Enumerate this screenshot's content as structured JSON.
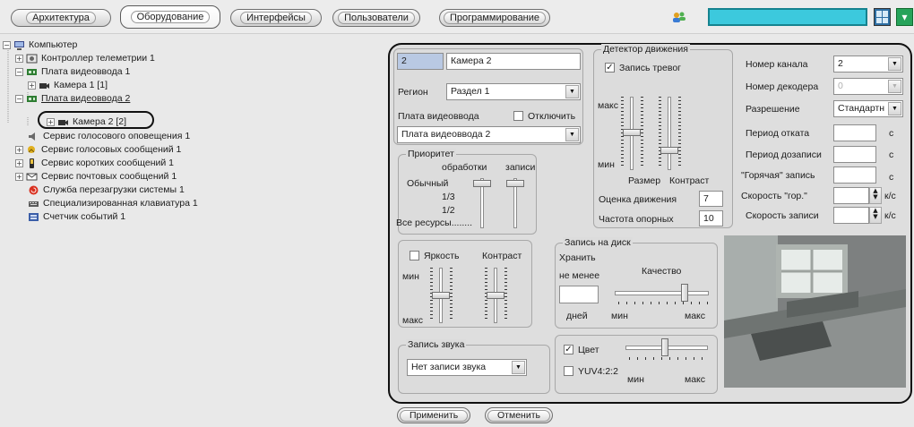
{
  "tabs": [
    "Архитектура",
    "Оборудование",
    "Интерфейсы",
    "Пользователи",
    "Программирование"
  ],
  "tabs_active_index": 1,
  "tree": [
    {
      "label": "Компьютер",
      "exp": "−",
      "icon": "computer-icon"
    },
    {
      "label": "Контроллер телеметрии 1",
      "exp": "+",
      "icon": "telemetry-icon"
    },
    {
      "label": "Плата видеоввода 1",
      "exp": "−",
      "icon": "capture-card-icon"
    },
    {
      "label": "Камера 1 [1]",
      "exp": "+",
      "icon": "camera-icon"
    },
    {
      "label": "Плата видеоввода 2",
      "exp": "−",
      "icon": "capture-card-icon"
    },
    {
      "label": "Камера 2 [2]",
      "exp": "+",
      "icon": "camera-icon"
    },
    {
      "label": "Сервис голосового оповещения 1",
      "exp": "",
      "icon": "voice-service-icon"
    },
    {
      "label": "Сервис голосовых сообщений 1",
      "exp": "+",
      "icon": "voice-messages-icon"
    },
    {
      "label": "Сервис коротких сообщений 1",
      "exp": "+",
      "icon": "sms-service-icon"
    },
    {
      "label": "Сервис почтовых сообщений 1",
      "exp": "+",
      "icon": "mail-service-icon"
    },
    {
      "label": "Служба перезагрузки системы 1",
      "exp": "",
      "icon": "reboot-service-icon"
    },
    {
      "label": "Специализированная клавиатура 1",
      "exp": "",
      "icon": "keyboard-icon"
    },
    {
      "label": "Счетчик событий 1",
      "exp": "",
      "icon": "event-counter-icon"
    }
  ],
  "camera": {
    "id": "2",
    "name": "Камера 2",
    "region_label": "Регион",
    "region_value": "Раздел 1",
    "board_label": "Плата видеоввода",
    "disable_label": "Отключить",
    "board_value": "Плата видеоввода 2"
  },
  "priority": {
    "title": "Приоритет",
    "processing": "обработки",
    "recording": "записи",
    "levels": [
      "Обычный",
      "1/3",
      "1/2",
      "Все ресурсы........"
    ]
  },
  "motion": {
    "title": "Детектор движения",
    "record_alarms": "Запись тревог",
    "max": "макс",
    "min": "мин",
    "size_label": "Размер",
    "contrast_label": "Контраст",
    "estimate_label": "Оценка движения",
    "estimate_value": "7",
    "ref_freq_label": "Частота опорных",
    "ref_freq_value": "10"
  },
  "params": {
    "channel_label": "Номер канала",
    "channel_value": "2",
    "decoder_label": "Номер декодера",
    "decoder_value": "0",
    "resolution_label": "Разрешение",
    "resolution_value": "Стандартн",
    "rollback_label": "Период отката",
    "rollback_unit": "с",
    "postrecord_label": "Период дозаписи",
    "postrecord_unit": "с",
    "hot_label": "\"Горячая\" запись",
    "hot_unit": "с",
    "hot_speed_label": "Скорость \"гор.\"",
    "hot_speed_unit": "к/с",
    "rec_speed_label": "Скорость записи",
    "rec_speed_unit": "к/с"
  },
  "brightness": {
    "brightness_label": "Яркость",
    "contrast_label": "Контраст",
    "min": "мин",
    "max": "макс"
  },
  "disk": {
    "title": "Запись на диск",
    "keep": "Хранить",
    "not_less": "не менее",
    "quality": "Качество",
    "days": "дней",
    "min": "мин",
    "max": "макс"
  },
  "sound": {
    "title": "Запись звука",
    "value": "Нет записи звука"
  },
  "color": {
    "color_label": "Цвет",
    "yuv_label": "YUV4:2:2",
    "min": "мин",
    "max": "макс"
  },
  "buttons": {
    "apply": "Применить",
    "cancel": "Отменить"
  },
  "colors": {
    "accent_search": "#3cc9dd",
    "panel_outline": "#111111"
  }
}
